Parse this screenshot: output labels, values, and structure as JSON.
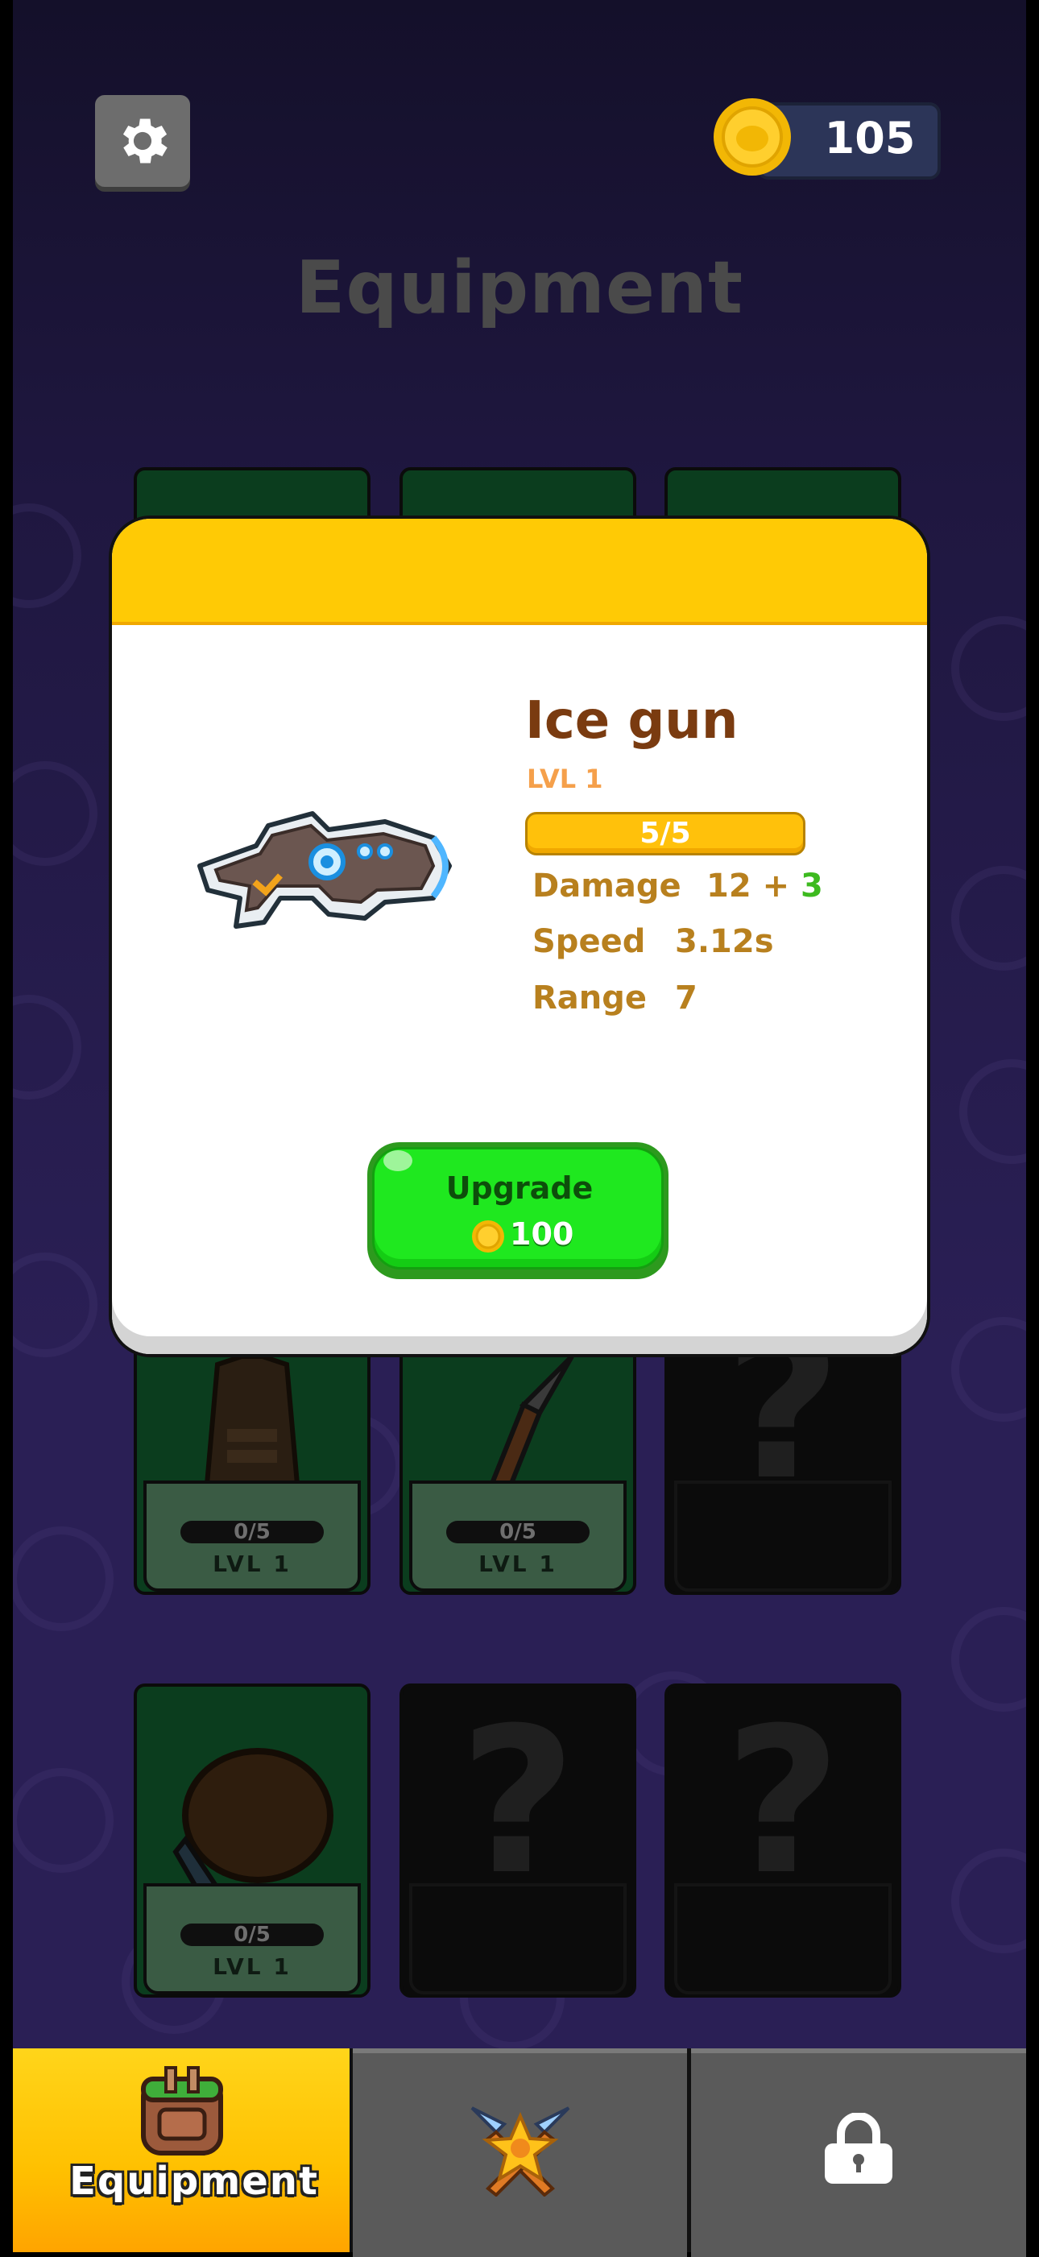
{
  "header": {
    "coins": "105",
    "title": "Equipment"
  },
  "item": {
    "name": "Ice gun",
    "level": "LVL 1",
    "progress_text": "5/5",
    "stats": [
      {
        "label": "Damage",
        "value": "12 + ",
        "bonus": "3"
      },
      {
        "label": "Speed",
        "value": "3.12s"
      },
      {
        "label": "Range",
        "value": "7"
      }
    ],
    "upgrade_label": "Upgrade",
    "upgrade_cost": "100"
  },
  "slots": {
    "vest": {
      "progress": "0/5",
      "level": "LVL 1"
    },
    "knife": {
      "progress": "0/5",
      "level": "LVL 1"
    },
    "glove": {
      "progress": "0/5",
      "level": "LVL 1"
    },
    "locked_mark": "?"
  },
  "nav": {
    "equipment_label": "Equipment"
  },
  "colors": {
    "accent_yellow": "#ffca05",
    "upgrade_green": "#1fe81f",
    "item_name": "#7a3b10",
    "bonus_green": "#3dba1f"
  }
}
